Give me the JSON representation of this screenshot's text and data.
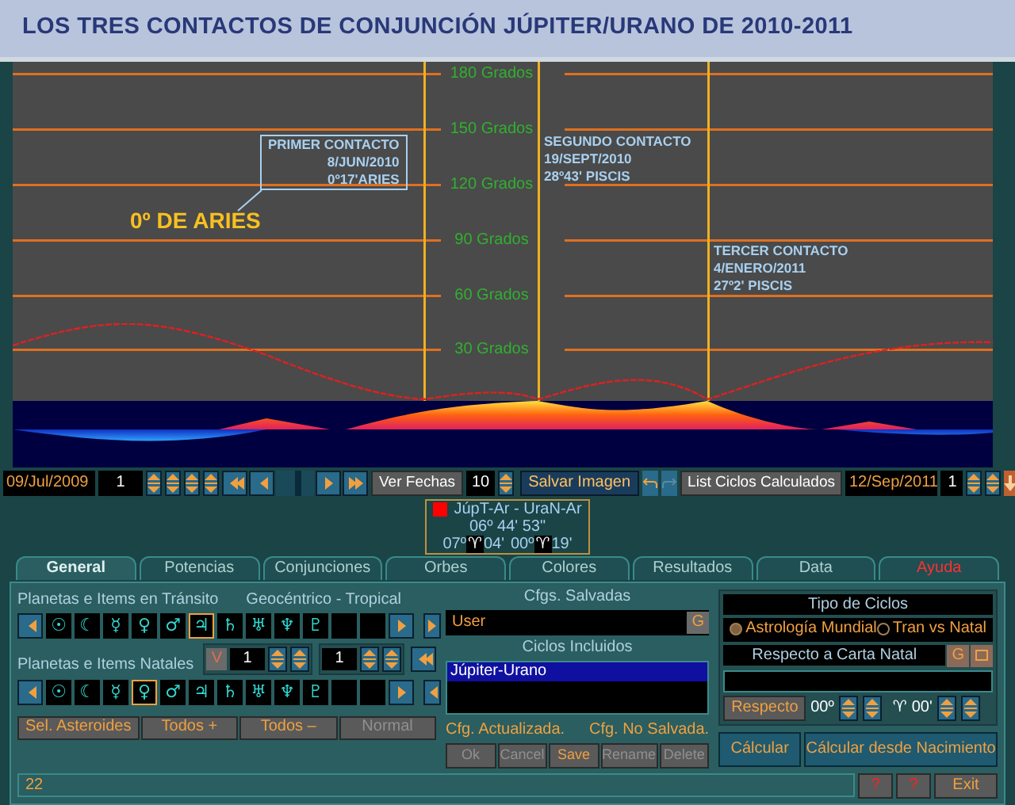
{
  "title": "LOS TRES CONTACTOS DE CONJUNCIÓN JÚPITER/URANO DE 2010-2011",
  "chart": {
    "grid_labels": [
      "180 Grados",
      "150 Grados",
      "120 Grados",
      "90 Grados",
      "60 Grados",
      "30 Grados"
    ],
    "annotations": [
      {
        "lines": [
          "PRIMER CONTACTO",
          "8/JUN/2010",
          "0º17'ARIES"
        ],
        "boxed": true
      },
      {
        "lines": [
          "SEGUNDO CONTACTO",
          "19/SEPT/2010",
          "28º43' PISCIS"
        ],
        "boxed": false
      },
      {
        "lines": [
          "TERCER CONTACTO",
          "4/ENERO/2011",
          "27º2' PISCIS"
        ],
        "boxed": false
      }
    ],
    "callout": "0º DE ARIES"
  },
  "toolbar": {
    "start_date": "09/Jul/2009",
    "step": "1",
    "view_dates": "Ver Fechas",
    "count": "10",
    "save_image": "Salvar Imagen",
    "list_cycles": "List Ciclos Calculados",
    "end_date": "12/Sep/2011",
    "end_step": "1"
  },
  "aspect": {
    "color": "#ff0000",
    "name": "JúpT-Ar - UraN-Ar",
    "distance": "06º 44' 53\"",
    "pos1_deg": "07º",
    "pos1_sign": "♈",
    "pos1_min": "04'",
    "pos2_deg": "00º",
    "pos2_sign": "♈",
    "pos2_min": "19'"
  },
  "tabs": [
    {
      "label": "General",
      "selected": true,
      "kind": "normal"
    },
    {
      "label": "Potencias",
      "selected": false,
      "kind": "normal"
    },
    {
      "label": "Conjunciones",
      "selected": false,
      "kind": "normal"
    },
    {
      "label": "Orbes",
      "selected": false,
      "kind": "normal"
    },
    {
      "label": "Colores",
      "selected": false,
      "kind": "normal"
    },
    {
      "label": "Resultados",
      "selected": false,
      "kind": "normal"
    },
    {
      "label": "Data",
      "selected": false,
      "kind": "normal"
    },
    {
      "label": "Ayuda",
      "selected": false,
      "kind": "help"
    }
  ],
  "general": {
    "transit_label": "Planetas e Items en Tránsito",
    "mode": "Geocéntrico - Tropical",
    "transit_planets": [
      {
        "glyph": "☉",
        "selected": false
      },
      {
        "glyph": "☾",
        "selected": false
      },
      {
        "glyph": "☿",
        "selected": false
      },
      {
        "glyph": "♀",
        "selected": false
      },
      {
        "glyph": "♂",
        "selected": false
      },
      {
        "glyph": "♃",
        "selected": true
      },
      {
        "glyph": "♄",
        "selected": false
      },
      {
        "glyph": "♅",
        "selected": false
      },
      {
        "glyph": "♆",
        "selected": false
      },
      {
        "glyph": "♇",
        "selected": false
      }
    ],
    "natal_label": "Planetas e Items Natales",
    "v_button": "V",
    "spin_1": "1",
    "spin_2": "1",
    "natal_planets": [
      {
        "glyph": "☉",
        "selected": false
      },
      {
        "glyph": "☾",
        "selected": false
      },
      {
        "glyph": "☿",
        "selected": false
      },
      {
        "glyph": "♀",
        "selected": true
      },
      {
        "glyph": "♂",
        "selected": false
      },
      {
        "glyph": "♃",
        "selected": false
      },
      {
        "glyph": "♄",
        "selected": false
      },
      {
        "glyph": "♅",
        "selected": false
      },
      {
        "glyph": "♆",
        "selected": false
      },
      {
        "glyph": "♇",
        "selected": false
      }
    ],
    "buttons": [
      {
        "label": "Sel. Asteroides",
        "disabled": false
      },
      {
        "label": "Todos +",
        "disabled": false
      },
      {
        "label": "Todos –",
        "disabled": false
      },
      {
        "label": "Normal",
        "disabled": true
      }
    ]
  },
  "configs": {
    "saved_label": "Cfgs. Salvadas",
    "saved_value": "User",
    "g_button": "G",
    "included_label": "Ciclos Incluidos",
    "included": [
      {
        "label": "Júpiter-Urano",
        "selected": true
      }
    ],
    "status_updated": "Cfg. Actualizada.",
    "status_unsaved": "Cfg. No Salvada.",
    "buttons": [
      {
        "label": "Ok",
        "disabled": true
      },
      {
        "label": "Cancel",
        "disabled": true
      },
      {
        "label": "Save",
        "disabled": false
      },
      {
        "label": "Rename",
        "disabled": true
      },
      {
        "label": "Delete",
        "disabled": true
      }
    ]
  },
  "cycle_type": {
    "label": "Tipo de Ciclos",
    "options": [
      {
        "label": "Astrología Mundial",
        "selected": true
      },
      {
        "label": "Tran vs Natal",
        "selected": false
      }
    ],
    "natal_label": "Respecto a Carta Natal",
    "g_button": "G",
    "respect_button": "Respecto",
    "deg": "00º",
    "sign": "♈",
    "min": "00'"
  },
  "actions": [
    "Cálcular",
    "Cálcular desde Nacimiento"
  ],
  "status": {
    "value": "22",
    "help_1": "?",
    "help_2": "?",
    "exit": "Exit"
  }
}
